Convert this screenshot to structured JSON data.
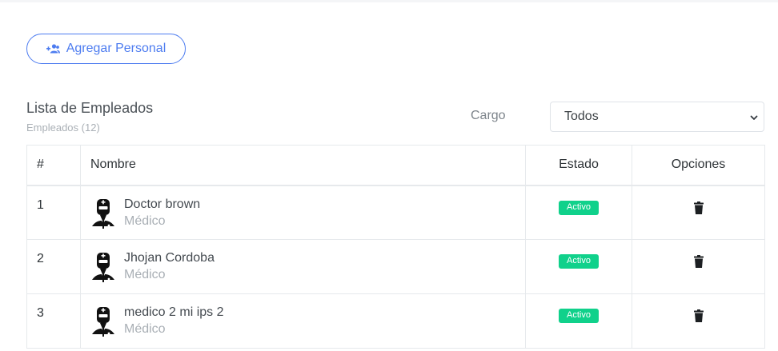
{
  "actions": {
    "add_staff_label": "Agregar Personal"
  },
  "list": {
    "title": "Lista de Empleados",
    "subtitle": "Empleados (12)"
  },
  "filter": {
    "label": "Cargo",
    "selected": "Todos"
  },
  "table": {
    "headers": {
      "num": "#",
      "name": "Nombre",
      "status": "Estado",
      "options": "Opciones"
    },
    "rows": [
      {
        "num": "1",
        "name": "Doctor brown",
        "role": "Médico",
        "status": "Activo"
      },
      {
        "num": "2",
        "name": "Jhojan Cordoba",
        "role": "Médico",
        "status": "Activo"
      },
      {
        "num": "3",
        "name": "medico 2 mi ips 2",
        "role": "Médico",
        "status": "Activo"
      }
    ]
  },
  "icons": {
    "add": "user-plus-icon",
    "avatar": "doctor-icon",
    "delete": "trash-icon",
    "dropdown": "chevron-down-icon"
  },
  "colors": {
    "accent": "#4d7cf0",
    "status_active": "#10d18b"
  }
}
